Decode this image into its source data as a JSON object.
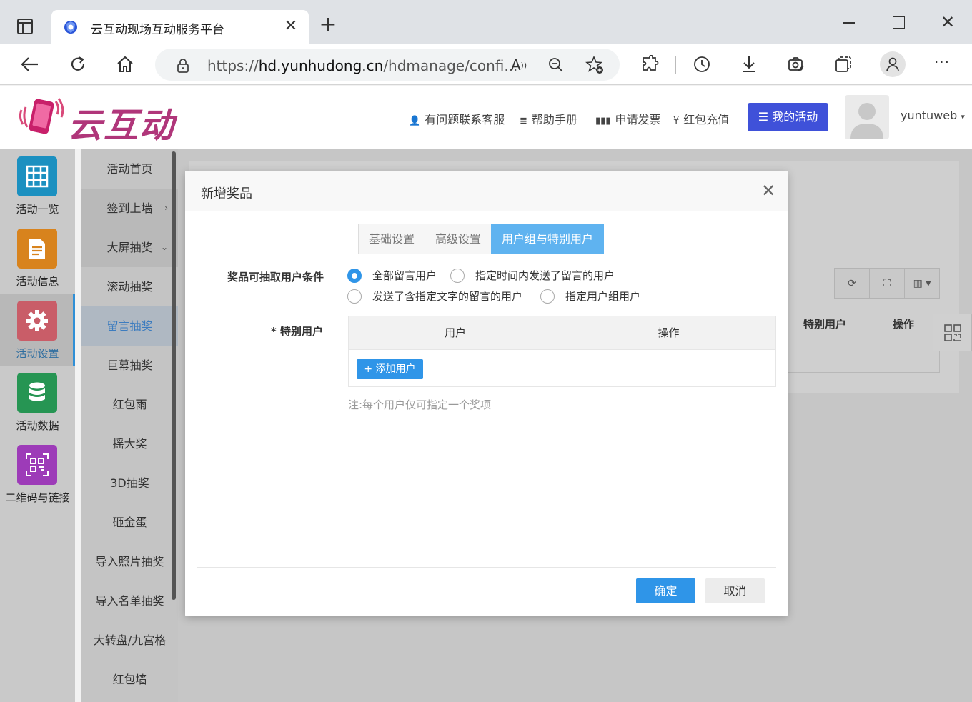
{
  "browser": {
    "tab_title": "云互动现场互动服务平台",
    "url_prefix": "https://",
    "url_domain": "hd.yunhudong.cn",
    "url_path": "/hdmanage/confi..."
  },
  "header": {
    "logo_text": "云互动",
    "links": {
      "contact": "有问题联系客服",
      "manual": "帮助手册",
      "invoice": "申请发票",
      "recharge": "红包充值"
    },
    "my_activity": "我的活动",
    "username": "yuntuweb",
    "brand_color": "#b0367a",
    "accent_color": "#3f51d9"
  },
  "sidebar_main": [
    {
      "label": "活动一览",
      "icon": "grid-icon",
      "color": "#1ba3d6"
    },
    {
      "label": "活动信息",
      "icon": "document-icon",
      "color": "#f0931e"
    },
    {
      "label": "活动设置",
      "icon": "gear-icon",
      "color": "#e0606e",
      "active": true
    },
    {
      "label": "活动数据",
      "icon": "database-icon",
      "color": "#2aa65c"
    },
    {
      "label": "二维码与链接",
      "icon": "qrcode-icon",
      "color": "#b23fd0"
    }
  ],
  "sidebar_sub": [
    {
      "label": "活动首页"
    },
    {
      "label": "签到上墙",
      "arrow": "›"
    },
    {
      "label": "大屏抽奖",
      "arrow": "⌄"
    },
    {
      "label": "滚动抽奖"
    },
    {
      "label": "留言抽奖",
      "active": true
    },
    {
      "label": "巨幕抽奖"
    },
    {
      "label": "红包雨"
    },
    {
      "label": "摇大奖"
    },
    {
      "label": "3D抽奖"
    },
    {
      "label": "砸金蛋"
    },
    {
      "label": "导入照片抽奖"
    },
    {
      "label": "导入名单抽奖"
    },
    {
      "label": "大转盘/九宫格"
    },
    {
      "label": "红包墙"
    }
  ],
  "background_table": {
    "col_special_user": "特别用户",
    "col_action": "操作"
  },
  "modal": {
    "title": "新增奖品",
    "tabs": [
      {
        "label": "基础设置"
      },
      {
        "label": "高级设置"
      },
      {
        "label": "用户组与特别用户",
        "active": true
      }
    ],
    "condition_label": "奖品可抽取用户条件",
    "conditions": [
      {
        "label": "全部留言用户",
        "checked": true
      },
      {
        "label": "指定时间内发送了留言的用户"
      },
      {
        "label": "发送了含指定文字的留言的用户"
      },
      {
        "label": "指定用户组用户"
      }
    ],
    "special_label": "* 特别用户",
    "table_headers": {
      "user": "用户",
      "action": "操作"
    },
    "add_user": "+ 添加用户",
    "note": "注:每个用户仅可指定一个奖项",
    "confirm": "确定",
    "cancel": "取消",
    "primary_color": "#2f95e8"
  }
}
